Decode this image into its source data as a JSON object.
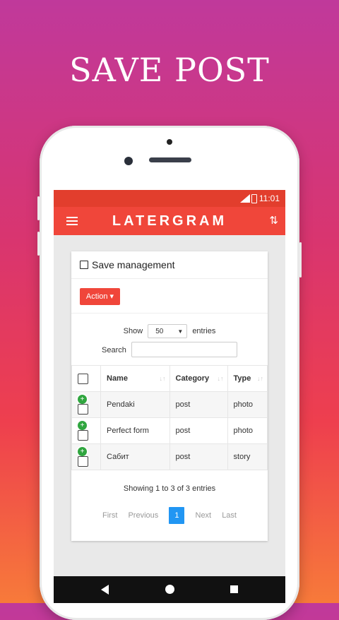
{
  "headline": "SAVE POST",
  "status": {
    "time": "11:01"
  },
  "app": {
    "title": "LATERGRAM"
  },
  "card": {
    "title": "Save management",
    "action_label": "Action ▾",
    "show_label": "Show",
    "entries_value": "50",
    "entries_label": "entries",
    "search_label": "Search",
    "columns": [
      "Name",
      "Category",
      "Type"
    ],
    "rows": [
      {
        "name": "Pendaki",
        "category": "post",
        "type": "photo"
      },
      {
        "name": "Perfect form",
        "category": "post",
        "type": "photo"
      },
      {
        "name": "Сабит",
        "category": "post",
        "type": "story"
      }
    ],
    "info": "Showing 1 to 3 of 3 entries",
    "pager": {
      "first": "First",
      "previous": "Previous",
      "current": "1",
      "next": "Next",
      "last": "Last"
    }
  },
  "colors": {
    "appbar": "#f0463a",
    "accent": "#2196f3",
    "add": "#30a63f"
  }
}
